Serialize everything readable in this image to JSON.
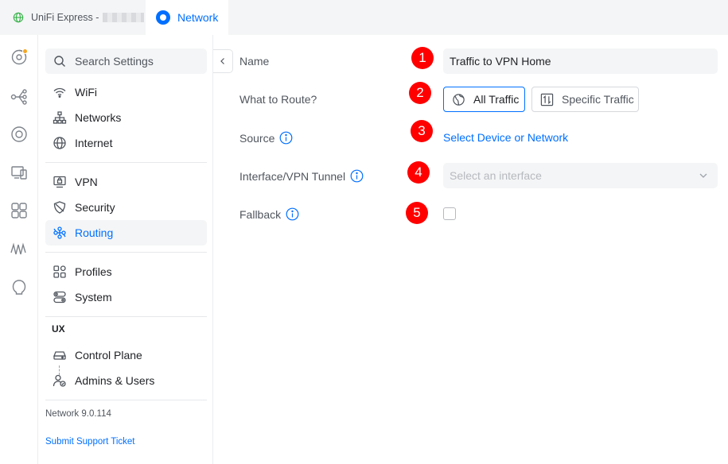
{
  "tabs": {
    "unifi_label": "UniFi Express -",
    "network_label": "Network"
  },
  "sidebar": {
    "search_placeholder": "Search Settings",
    "items": [
      {
        "label": "WiFi",
        "icon": "wifi-icon"
      },
      {
        "label": "Networks",
        "icon": "topology-icon"
      },
      {
        "label": "Internet",
        "icon": "globe-icon"
      },
      {
        "label": "VPN",
        "icon": "vpn-icon"
      },
      {
        "label": "Security",
        "icon": "shield-icon"
      },
      {
        "label": "Routing",
        "icon": "routing-icon",
        "active": true
      },
      {
        "label": "Profiles",
        "icon": "profiles-icon"
      },
      {
        "label": "System",
        "icon": "system-icon"
      }
    ],
    "section_ux": "UX",
    "ux_items": [
      {
        "label": "Control Plane",
        "icon": "control-plane-icon"
      },
      {
        "label": "Admins & Users",
        "icon": "admins-users-icon"
      }
    ],
    "version": "Network 9.0.114",
    "support_link": "Submit Support Ticket"
  },
  "form": {
    "name_label": "Name",
    "name_value": "Traffic to VPN Home",
    "route_label": "What to Route?",
    "all_traffic": "All Traffic",
    "specific_traffic": "Specific Traffic",
    "source_label": "Source",
    "source_link": "Select Device or Network",
    "interface_label": "Interface/VPN Tunnel",
    "interface_placeholder": "Select an interface",
    "fallback_label": "Fallback"
  },
  "badges": [
    "1",
    "2",
    "3",
    "4",
    "5"
  ],
  "colors": {
    "accent": "#006fff",
    "badge": "#ff0000",
    "notification_dot": "#f5a623"
  }
}
